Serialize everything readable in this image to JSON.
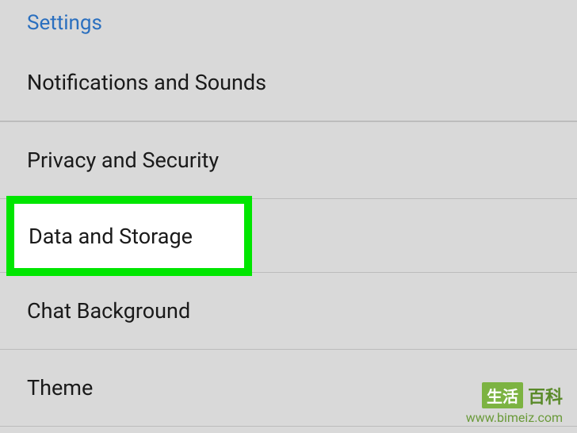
{
  "header": {
    "title": "Settings"
  },
  "menu": {
    "items": [
      {
        "label": "Notifications and Sounds"
      },
      {
        "label": "Privacy and Security"
      },
      {
        "label": "Data and Storage"
      },
      {
        "label": "Chat Background"
      },
      {
        "label": "Theme"
      }
    ]
  },
  "watermark": {
    "badge": "生活",
    "text": "百科",
    "url": "www.bimeiz.com"
  }
}
